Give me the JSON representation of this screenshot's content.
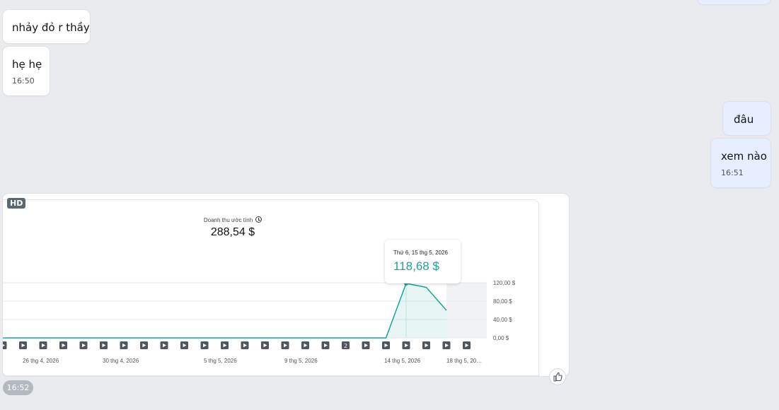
{
  "messages": [
    {
      "text": "nhảy đỏ r thầy"
    },
    {
      "text": "hẹ hẹ",
      "time": "16:50"
    },
    {
      "text": "đâu"
    },
    {
      "text": "xem nào",
      "time": "16:51"
    }
  ],
  "image_message": {
    "badge": "HD",
    "time": "16:52",
    "reaction_icon": "thumbs-up-icon"
  },
  "screenshot": {
    "revenue_label": "Doanh thu ước tính",
    "revenue_value": "288,54 $",
    "tooltip_date": "Thứ 6, 15 thg 5, 2026",
    "tooltip_value": "118,68 $"
  },
  "chart_data": {
    "type": "line",
    "x_tick_labels": [
      "26 thg 4, 2026",
      "30 thg 4, 2026",
      "5 thg 5, 2026",
      "9 thg 5, 2026",
      "14 thg 5, 2026",
      "18 thg 5, 20…"
    ],
    "y_tick_labels": [
      "0,00 $",
      "40,00 $",
      "80,00 $",
      "120,00 $"
    ],
    "ylim": [
      0,
      120
    ],
    "series": [
      {
        "values": [
          0,
          0,
          0,
          0,
          0,
          0,
          0,
          0,
          0,
          0,
          0,
          0,
          0,
          0,
          0,
          0,
          0,
          0,
          0,
          0,
          118.68,
          110,
          60
        ],
        "color": "#17a597"
      }
    ],
    "highlight_index": 20,
    "marker_badges": [
      {
        "index": 17,
        "text": "2"
      }
    ],
    "grid": true
  }
}
